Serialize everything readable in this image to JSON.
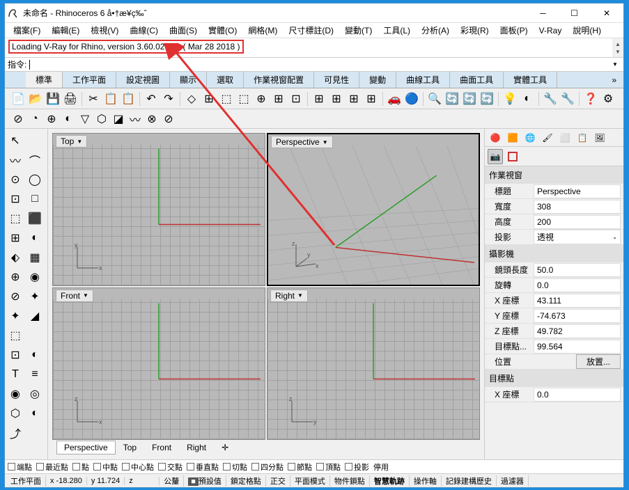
{
  "title": "未命名 - Rhinoceros 6 å•†æ¥­ç‰ˆ",
  "menus": [
    "檔案(F)",
    "編輯(E)",
    "檢視(V)",
    "曲線(C)",
    "曲面(S)",
    "實體(O)",
    "網格(M)",
    "尺寸標註(D)",
    "變動(T)",
    "工具(L)",
    "分析(A)",
    "彩現(R)",
    "面板(P)",
    "V-Ray",
    "說明(H)"
  ],
  "vray_log": "Loading V-Ray for Rhino, version 3.60.02 adv ( Mar 28 2018 )",
  "cmd_label": "指令:",
  "tabs": [
    "標準",
    "工作平面",
    "設定視圖",
    "顯示",
    "選取",
    "作業視窗配置",
    "可見性",
    "變動",
    "曲線工具",
    "曲面工具",
    "實體工具"
  ],
  "tab_more": "»",
  "viewports": {
    "top": "Top",
    "perspective": "Perspective",
    "front": "Front",
    "right": "Right"
  },
  "vp_tabs": [
    "Perspective",
    "Top",
    "Front",
    "Right"
  ],
  "sub_tab_plus": "✛",
  "panel_title_viewport": "作業視窗",
  "panel_camera_title": "攝影機",
  "panel_target_title": "目標點",
  "props_viewport": [
    {
      "label": "標題",
      "value": "Perspective"
    },
    {
      "label": "寬度",
      "value": "308"
    },
    {
      "label": "高度",
      "value": "200"
    },
    {
      "label": "投影",
      "value": "透視",
      "select": true
    }
  ],
  "props_camera": [
    {
      "label": "鏡頭長度",
      "value": "50.0"
    },
    {
      "label": "旋轉",
      "value": "0.0"
    },
    {
      "label": "X 座標",
      "value": "43.111"
    },
    {
      "label": "Y 座標",
      "value": "-74.673"
    },
    {
      "label": "Z 座標",
      "value": "49.782"
    },
    {
      "label": "目標點...",
      "value": "99.564"
    }
  ],
  "props_loc_label": "位置",
  "props_loc_btn": "放置...",
  "props_target": [
    {
      "label": "X 座標",
      "value": "0.0"
    }
  ],
  "osnaps": [
    "端點",
    "最近點",
    "點",
    "中點",
    "中心點",
    "交點",
    "垂直點",
    "切點",
    "四分點",
    "節點",
    "頂點",
    "投影",
    "停用"
  ],
  "status": {
    "plane": "工作平面",
    "x": "x -18.280",
    "y": "y 11.724",
    "z": "z",
    "unit": "公釐",
    "def": "預設值",
    "items": [
      "鎖定格點",
      "正交",
      "平面模式",
      "物件鎖點",
      "智慧軌跡",
      "操作軸",
      "記錄建構歷史",
      "過濾器"
    ]
  }
}
